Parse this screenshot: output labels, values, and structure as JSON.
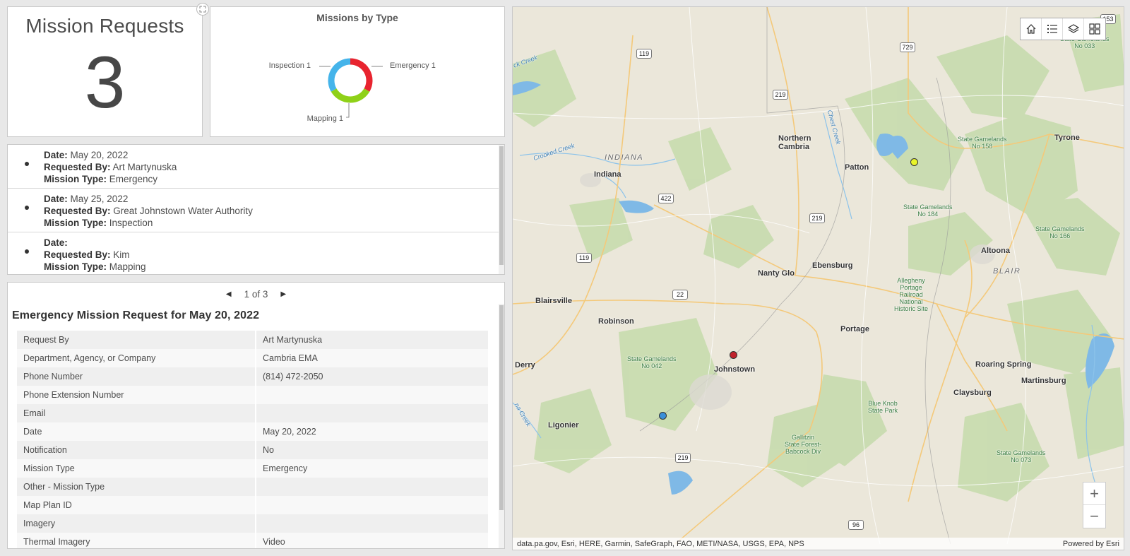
{
  "indicator": {
    "title": "Mission Requests",
    "value": "3"
  },
  "chart": {
    "title": "Missions by Type",
    "colors": {
      "Emergency": "#e8242f",
      "Mapping": "#8fd118",
      "Inspection": "#45b4ea"
    }
  },
  "chart_data": {
    "type": "pie",
    "title": "Missions by Type",
    "categories": [
      "Emergency",
      "Mapping",
      "Inspection"
    ],
    "values": [
      1,
      1,
      1
    ],
    "labels": [
      "Emergency 1",
      "Mapping 1",
      "Inspection 1"
    ]
  },
  "list": {
    "items": [
      {
        "date_label": "Date:",
        "date": "May 20, 2022",
        "by_label": "Requested By:",
        "by": "Art Martynuska",
        "type_label": "Mission Type:",
        "type": "Emergency"
      },
      {
        "date_label": "Date:",
        "date": "May 25, 2022",
        "by_label": "Requested By:",
        "by": "Great Johnstown Water Authority",
        "type_label": "Mission Type:",
        "type": "Inspection"
      },
      {
        "date_label": "Date:",
        "date": "",
        "by_label": "Requested By:",
        "by": "Kim",
        "type_label": "Mission Type:",
        "type": "Mapping"
      }
    ]
  },
  "details": {
    "pager": "1 of 3",
    "title": "Emergency Mission Request for May 20, 2022",
    "rows": [
      {
        "k": "Request By",
        "v": "Art Martynuska"
      },
      {
        "k": "Department, Agency, or Company",
        "v": "Cambria EMA"
      },
      {
        "k": "Phone Number",
        "v": "(814) 472-2050"
      },
      {
        "k": "Phone Extension Number",
        "v": ""
      },
      {
        "k": "Email",
        "v": ""
      },
      {
        "k": "Date",
        "v": "May 20, 2022"
      },
      {
        "k": "Notification",
        "v": "No"
      },
      {
        "k": "Mission Type",
        "v": "Emergency"
      },
      {
        "k": "Other - Mission Type",
        "v": ""
      },
      {
        "k": "Map Plan ID",
        "v": ""
      },
      {
        "k": "Imagery",
        "v": ""
      },
      {
        "k": "Thermal Imagery",
        "v": "Video"
      }
    ]
  },
  "map": {
    "attribution": "data.pa.gov, Esri, HERE, Garmin, SafeGraph, FAO, METI/NASA, USGS, EPA, NPS",
    "powered_by": "Powered by Esri",
    "zoom_in": "+",
    "zoom_out": "−",
    "cities": {
      "northern_cambria": [
        "Northern",
        "Cambria"
      ],
      "tyrone": "Tyrone",
      "patton": "Patton",
      "indiana": "Indiana",
      "altoona": "Altoona",
      "nanty_glo": "Nanty Glo",
      "ebensburg": "Ebensburg",
      "blairsville": "Blairsville",
      "robinson": "Robinson",
      "portage": "Portage",
      "derry": "Derry",
      "johnstown": "Johnstown",
      "roaring_spring": "Roaring Spring",
      "martinsburg": "Martinsburg",
      "claysburg": "Claysburg",
      "ligonier": "Ligonier"
    },
    "counties": {
      "indiana": "INDIANA",
      "blair": "BLAIR"
    },
    "parks": {
      "sgl_033": [
        "State Gamelands",
        "No 033"
      ],
      "sgl_158": [
        "State Gamelands",
        "No 158"
      ],
      "sgl_184": [
        "State Gamelands",
        "No 184"
      ],
      "sgl_166": [
        "State Gamelands",
        "No 166"
      ],
      "allegheny_portage": [
        "Allegheny",
        "Portage",
        "Railroad",
        "National",
        "Historic Site"
      ],
      "sgl_042": [
        "State Gamelands",
        "No 042"
      ],
      "blue_knob": [
        "Blue Knob",
        "State Park"
      ],
      "gallitzin": [
        "Gallitzin",
        "State Forest-",
        "Babcock Div"
      ],
      "sgl_073": [
        "State Gamelands",
        "No 073"
      ]
    },
    "water": {
      "crooked_creek": "Crooked Creek",
      "chest_creek": "Chest Creek",
      "ck_creek": "ck Creek",
      "na_creek": "na Creek"
    },
    "routes": [
      "153",
      "119",
      "729",
      "219",
      "422",
      "219",
      "119",
      "22",
      "219",
      "96"
    ],
    "markers": [
      {
        "type": "Inspection",
        "color": "#e8f52a"
      },
      {
        "type": "Emergency",
        "color": "#c0222c"
      },
      {
        "type": "Mapping",
        "color": "#3b8fd9"
      }
    ]
  }
}
